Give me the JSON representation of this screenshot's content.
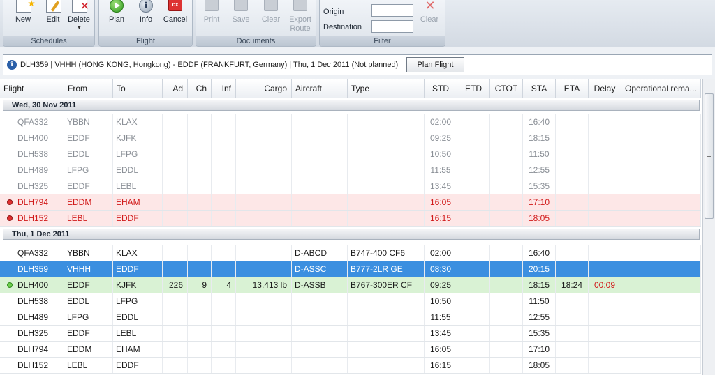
{
  "ribbon": {
    "schedules": {
      "label": "Schedules",
      "new": "New",
      "edit": "Edit",
      "delete": "Delete"
    },
    "flight": {
      "label": "Flight",
      "plan": "Plan",
      "info": "Info",
      "cancel": "Cancel",
      "cancel_icon_text": "cx"
    },
    "documents": {
      "label": "Documents",
      "print": "Print",
      "save": "Save",
      "clear": "Clear",
      "export_route": "Export Route"
    },
    "filter": {
      "label": "Filter",
      "origin_label": "Origin",
      "destination_label": "Destination",
      "clear": "Clear"
    }
  },
  "infobar": {
    "text": "DLH359 | VHHH (HONG KONG, Hongkong) - EDDF (FRANKFURT, Germany)  | Thu, 1 Dec 2011 (Not planned)",
    "plan_flight_button": "Plan Flight"
  },
  "grid": {
    "columns": [
      "Flight",
      "From",
      "To",
      "Ad",
      "Ch",
      "Inf",
      "Cargo",
      "Aircraft",
      "Type",
      "STD",
      "ETD",
      "CTOT",
      "STA",
      "ETA",
      "Delay",
      "Operational rema..."
    ],
    "group1": "Wed, 30 Nov 2011",
    "group2": "Thu, 1 Dec 2011",
    "rows1": [
      {
        "flight": "QFA332",
        "from": "YBBN",
        "to": "KLAX",
        "std": "02:00",
        "sta": "16:40"
      },
      {
        "flight": "DLH400",
        "from": "EDDF",
        "to": "KJFK",
        "std": "09:25",
        "sta": "18:15"
      },
      {
        "flight": "DLH538",
        "from": "EDDL",
        "to": "LFPG",
        "std": "10:50",
        "sta": "11:50"
      },
      {
        "flight": "DLH489",
        "from": "LFPG",
        "to": "EDDL",
        "std": "11:55",
        "sta": "12:55"
      },
      {
        "flight": "DLH325",
        "from": "EDDF",
        "to": "LEBL",
        "std": "13:45",
        "sta": "15:35"
      },
      {
        "flight": "DLH794",
        "from": "EDDM",
        "to": "EHAM",
        "std": "16:05",
        "sta": "17:10"
      },
      {
        "flight": "DLH152",
        "from": "LEBL",
        "to": "EDDF",
        "std": "16:15",
        "sta": "18:05"
      }
    ],
    "rows2": [
      {
        "flight": "QFA332",
        "from": "YBBN",
        "to": "KLAX",
        "aircraft": "D-ABCD",
        "type": "B747-400 CF6",
        "std": "02:00",
        "sta": "16:40"
      },
      {
        "flight": "DLH359",
        "from": "VHHH",
        "to": "EDDF",
        "aircraft": "D-ASSC",
        "type": "B777-2LR GE",
        "std": "08:30",
        "sta": "20:15"
      },
      {
        "flight": "DLH400",
        "from": "EDDF",
        "to": "KJFK",
        "ad": "226",
        "ch": "9",
        "inf": "4",
        "cargo": "13.413 lb",
        "aircraft": "D-ASSB",
        "type": "B767-300ER CF",
        "std": "09:25",
        "sta": "18:15",
        "eta": "18:24",
        "delay": "00:09"
      },
      {
        "flight": "DLH538",
        "from": "EDDL",
        "to": "LFPG",
        "std": "10:50",
        "sta": "11:50"
      },
      {
        "flight": "DLH489",
        "from": "LFPG",
        "to": "EDDL",
        "std": "11:55",
        "sta": "12:55"
      },
      {
        "flight": "DLH325",
        "from": "EDDF",
        "to": "LEBL",
        "std": "13:45",
        "sta": "15:35"
      },
      {
        "flight": "DLH794",
        "from": "EDDM",
        "to": "EHAM",
        "std": "16:05",
        "sta": "17:10"
      },
      {
        "flight": "DLH152",
        "from": "LEBL",
        "to": "EDDF",
        "std": "16:15",
        "sta": "18:05"
      }
    ]
  },
  "colors": {
    "selected_row": "#3b8fe0",
    "alert_row": "#fde7e7",
    "active_row": "#d9f2d4",
    "alert_text": "#d11a1a"
  }
}
